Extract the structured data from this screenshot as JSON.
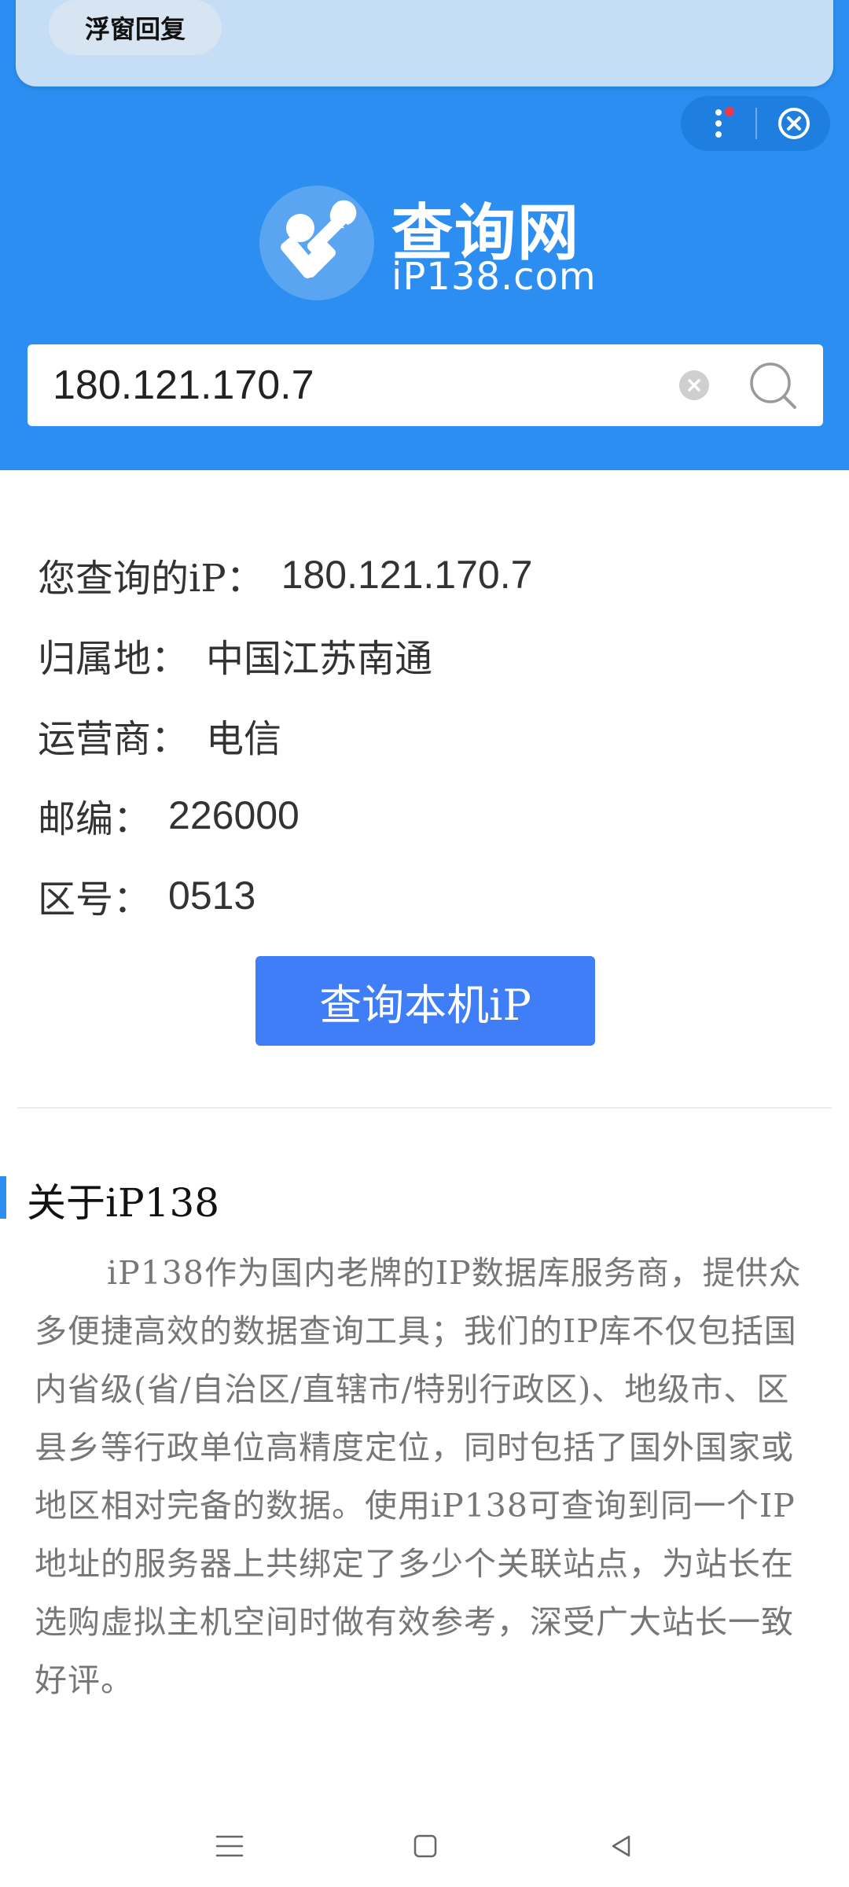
{
  "floating": {
    "reply_label": "浮窗回复"
  },
  "controls": {
    "more_icon": "more-vertical-icon",
    "close_icon": "close-circle-icon"
  },
  "logo": {
    "title": "查询网",
    "subtitle": "iP138.com"
  },
  "search": {
    "value": "180.121.170.7"
  },
  "result": {
    "rows": [
      {
        "label": "您查询的iP：",
        "value": "180.121.170.7"
      },
      {
        "label": "归属地：",
        "value": "中国江苏南通"
      },
      {
        "label": "运营商：",
        "value": "电信"
      },
      {
        "label": "邮编：",
        "value": "226000"
      },
      {
        "label": "区号：",
        "value": "0513"
      }
    ]
  },
  "query_button": "查询本机iP",
  "about": {
    "title": "关于iP138",
    "text": "iP138作为国内老牌的IP数据库服务商，提供众多便捷高效的数据查询工具；我们的IP库不仅包括国内省级(省/自治区/直辖市/特别行政区)、地级市、区县乡等行政单位高精度定位，同时包括了国外国家或地区相对完备的数据。使用iP138可查询到同一个IP地址的服务器上共绑定了多少个关联站点，为站长在选购虚拟主机空间时做有效参考，深受广大站长一致好评。"
  },
  "navbar": {
    "menu_icon": "menu-icon",
    "home_icon": "home-square-icon",
    "back_icon": "back-triangle-icon"
  },
  "colors": {
    "header_blue": "#2b8ef0",
    "button_blue": "#3f7ef6"
  }
}
